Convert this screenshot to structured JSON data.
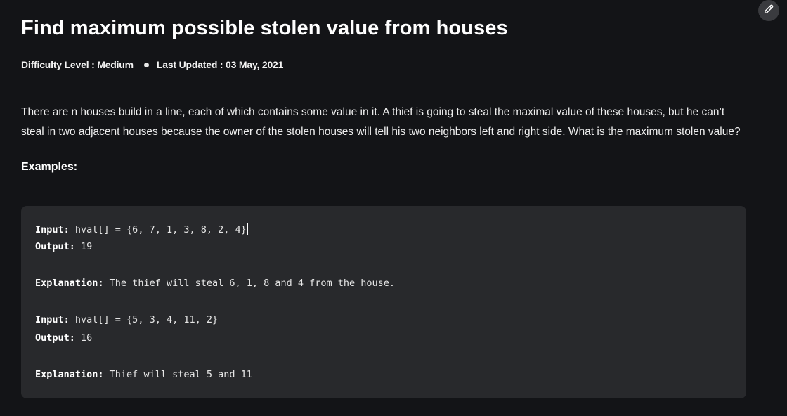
{
  "article": {
    "title": "Find maximum possible stolen value from houses",
    "difficulty": "Difficulty Level : Medium",
    "last_updated": "Last Updated : 03 May, 2021",
    "description": "There are n houses build in a line, each of which contains some value in it. A thief is going to steal the maximal value of these houses, but he can’t steal in two adjacent houses because the owner of the stolen houses will tell his two neighbors left and right side. What is the maximum stolen value?",
    "examples_heading": "Examples:"
  },
  "edit_icon": "pencil-icon",
  "examples": [
    {
      "input_label": "Input:",
      "input_value": " hval[] = {6, 7, 1, 3, 8, 2, 4}",
      "output_label": "Output:",
      "output_value": " 19",
      "explanation_label": "Explanation:",
      "explanation_value": " The thief will steal 6, 1, 8 and 4 from the house."
    },
    {
      "input_label": "Input:",
      "input_value": " hval[] = {5, 3, 4, 11, 2}",
      "output_label": "Output:",
      "output_value": " 16",
      "explanation_label": "Explanation:",
      "explanation_value": " Thief will steal 5 and 11"
    }
  ]
}
